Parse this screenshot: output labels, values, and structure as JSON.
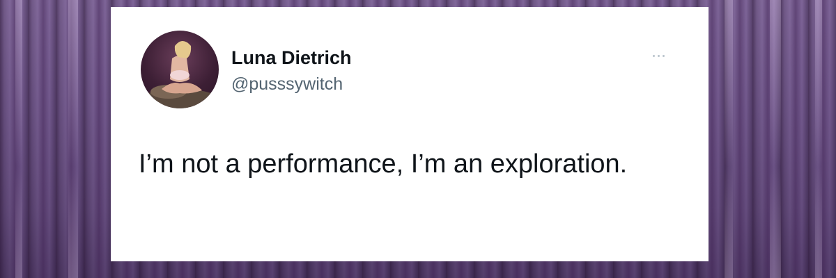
{
  "tweet": {
    "author_name": "Luna Dietrich",
    "author_handle": "@pusssywitch",
    "text": "I’m not a performance, I’m an exploration.",
    "avatar_icon": "profile-photo",
    "more_icon": "more-options-icon"
  },
  "colors": {
    "background": "#6d5587",
    "card": "#ffffff",
    "name_text": "#0f1419",
    "handle_text": "#536471",
    "body_text": "#0f1419"
  }
}
